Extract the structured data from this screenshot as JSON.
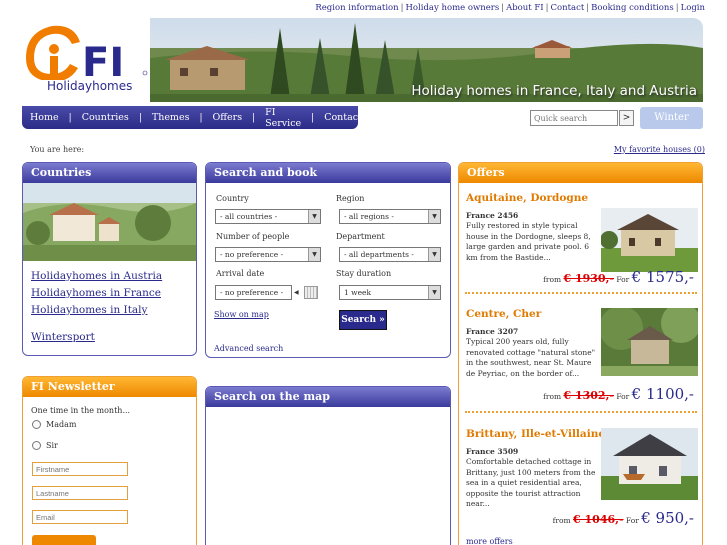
{
  "top_links": [
    "Region information",
    "Holiday home owners",
    "About FI",
    "Contact",
    "Booking conditions",
    "Login"
  ],
  "brand": {
    "name": "Holidayhomes",
    "tagline": "Holiday homes in France, Italy and Austria"
  },
  "nav": [
    "Home",
    "Countries",
    "Themes",
    "Offers",
    "FI Service",
    "Contact"
  ],
  "quick_search": {
    "placeholder": "Quick search",
    "button": ">"
  },
  "winter_label": "Winter",
  "you_are_here": "You are here:",
  "favorites": "My favorite houses (0)",
  "countries": {
    "title": "Countries",
    "links": [
      "Holidayhomes in Austria",
      "Holidayhomes in France",
      "Holidayhomes in Italy"
    ],
    "extra": "Wintersport"
  },
  "newsletter": {
    "title": "FI Newsletter",
    "intro": "One time in the month...",
    "salutations": [
      "Madam",
      "Sir"
    ],
    "fields": [
      "Firstname",
      "Lastname",
      "Email"
    ]
  },
  "search": {
    "title": "Search and book",
    "country_label": "Country",
    "country_value": "- all countries -",
    "region_label": "Region",
    "region_value": "- all regions -",
    "people_label": "Number of people",
    "people_value": "- no preference -",
    "dept_label": "Department",
    "dept_value": "- all departments -",
    "arrival_label": "Arrival date",
    "arrival_value": "- no preference -",
    "stay_label": "Stay duration",
    "stay_value": "1 week",
    "show_map": "Show on map",
    "search_btn": "Search »",
    "advanced": "Advanced search"
  },
  "map": {
    "title": "Search on the map"
  },
  "offers": {
    "title": "Offers",
    "items": [
      {
        "title": "Aquitaine, Dordogne",
        "ref": "France 2456",
        "desc": "Fully restored in style typical house in the Dordogne, sleeps 8, large garden and private pool. 6 km from the Bastide...",
        "from": "from",
        "old": "€ 1930,-",
        "for": "For",
        "new": "€ 1575,-"
      },
      {
        "title": "Centre, Cher",
        "ref": "France 3207",
        "desc": "Typical 200 years old, fully renovated cottage \"natural stone\" in the southwest, near St. Maure de Peyriac, on the border of...",
        "from": "from",
        "old": "€ 1302,-",
        "for": "For",
        "new": "€ 1100,-"
      },
      {
        "title": "Brittany, Ille-et-Villaine",
        "ref": "France 3509",
        "desc": "Comfortable detached cottage in Brittany, just 100 meters from the sea in a quiet residential area, opposite the tourist attraction near...",
        "from": "from",
        "old": "€ 1046,-",
        "for": "For",
        "new": "€ 950,-"
      }
    ],
    "more": "more offers"
  }
}
